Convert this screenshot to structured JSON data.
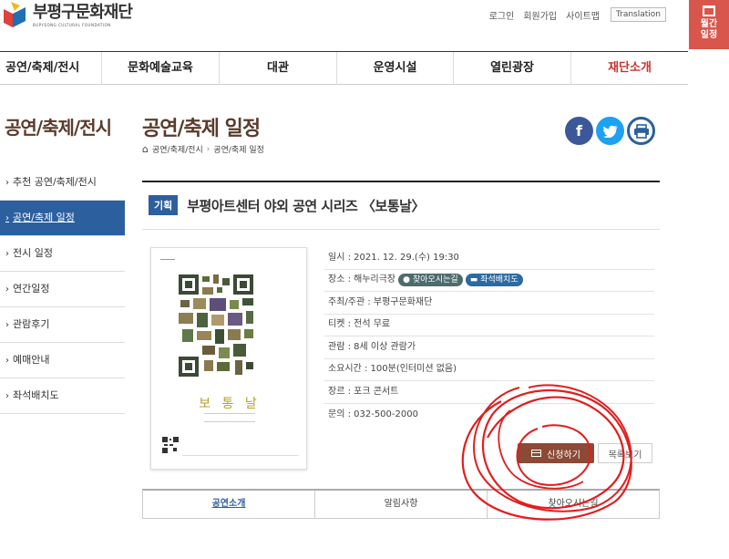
{
  "header": {
    "logo_text": "부평구문화재단",
    "logo_sub": "BUPYEONG CULTURAL FOUNDATION",
    "util": {
      "login": "로그인",
      "join": "회원가입",
      "sitemap": "사이트맵",
      "translation": "Translation"
    }
  },
  "monthly_tab": {
    "label_1": "월간",
    "label_2": "일정"
  },
  "gnb": [
    "공연/축제/전시",
    "문화예술교육",
    "대관",
    "운영시설",
    "열린광장",
    "재단소개"
  ],
  "sidebar": {
    "title": "공연/축제/전시",
    "items": [
      "추천 공연/축제/전시",
      "공연/축제 일정",
      "전시 일정",
      "연간일정",
      "관람후기",
      "예매안내",
      "좌석배치도"
    ]
  },
  "page": {
    "title": "공연/축제 일정",
    "breadcrumb": [
      "공연/축제/전시",
      "공연/축제 일정"
    ]
  },
  "event": {
    "tag": "기획",
    "title": "부평아트센터 야외 공연 시리즈 〈보통날〉",
    "poster_title": "보 통 날",
    "rows": [
      "일시 : 2021. 12. 29.(수) 19:30",
      "장소 : 해누리극장",
      "주최/주관 : 부평구문화재단",
      "티켓 : 전석 무료",
      "관람 : 8세 이상 관람가",
      "소요시간 : 100분(인터미션 없음)",
      "장르 : 포크 콘서트",
      "문의 : 032-500-2000"
    ],
    "badge_location": "찾아오시는길",
    "badge_seat": "좌석배치도",
    "apply_button": "신청하기",
    "list_button": "목록보기"
  },
  "tabs": [
    "공연소개",
    "알림사항",
    "찾아오시는길"
  ],
  "colors": {
    "primary_blue": "#2c5f9e",
    "brown": "#5a3b2b",
    "apply_brown": "#8b4a36",
    "accent_red": "#d9564c"
  }
}
